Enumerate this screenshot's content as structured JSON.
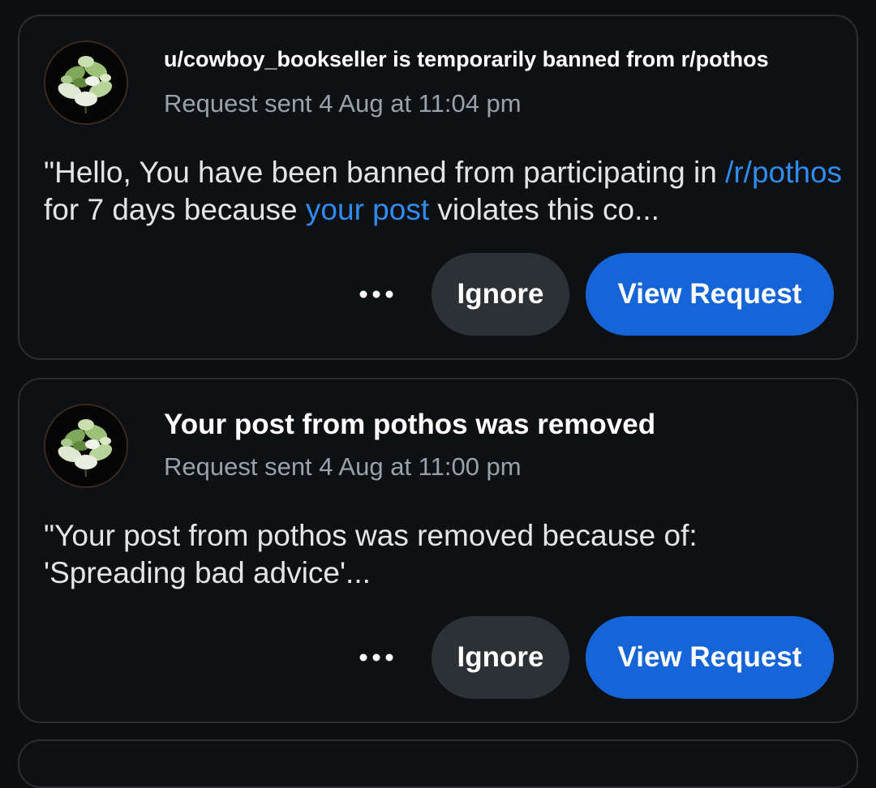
{
  "requests": [
    {
      "title": "u/cowboy_bookseller is temporarily banned from r/pothos",
      "meta": "Request sent 4 Aug at 11:04 pm",
      "message": {
        "part1": "\"Hello, You have been banned from participating in ",
        "link1": "/r/pothos",
        "part2": " for 7 days because ",
        "link2": "your post",
        "part3": " violates this co..."
      },
      "more_icon": "ellipsis-icon",
      "ignore_label": "Ignore",
      "view_label": "View Request"
    },
    {
      "title": "Your post from pothos was removed",
      "meta": "Request sent 4 Aug at 11:00 pm",
      "message": {
        "part1": "\"Your post from pothos was removed because of: 'Spreading bad advice'..."
      },
      "more_icon": "ellipsis-icon",
      "ignore_label": "Ignore",
      "view_label": "View Request"
    }
  ],
  "colors": {
    "background": "#0c0e11",
    "card_border": "#2a2e33",
    "link": "#2f8cf0",
    "primary_button": "#1565d8",
    "secondary_button": "#2b3135",
    "meta_text": "#98a2aa"
  }
}
